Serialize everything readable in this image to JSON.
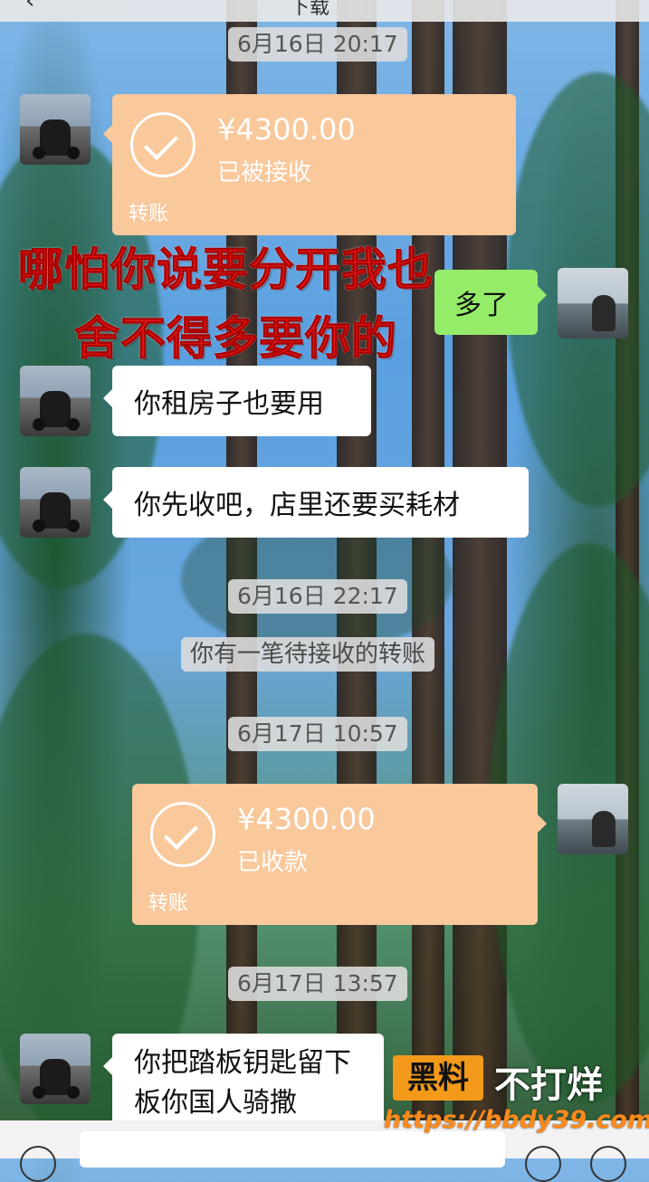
{
  "header": {
    "back_icon": "‹",
    "title": "下载"
  },
  "messages": {
    "time1": "6月16日 20:17",
    "transfer1": {
      "amount": "¥4300.00",
      "status": "已被接收",
      "label": "转账"
    },
    "reply_green": "多了",
    "msg1": "你租房子也要用",
    "msg2": "你先收吧，店里还要买耗材",
    "time2": "6月16日 22:17",
    "system_notice": "你有一笔待接收的转账",
    "time3": "6月17日 10:57",
    "transfer2": {
      "amount": "¥4300.00",
      "status": "已收款",
      "label": "转账"
    },
    "time4": "6月17日 13:57",
    "msg3_line1": "你把踏板钥匙留下",
    "msg3_line2": "板你国人骑撒"
  },
  "overlay_caption": {
    "line1": "哪怕你说要分开我也",
    "line2": "舍不得多要你的"
  },
  "watermark": {
    "box_text": "黑料",
    "text": "不打烊",
    "url": "https://bbdy39.com"
  },
  "colors": {
    "transfer_bg": "#f9c89b",
    "green_bubble": "#95ec69",
    "overlay_text": "#e81c1c",
    "watermark_orange": "#f39a1a"
  },
  "icons": [
    "back-icon",
    "check-icon",
    "voice-icon",
    "emoji-icon",
    "plus-icon"
  ]
}
